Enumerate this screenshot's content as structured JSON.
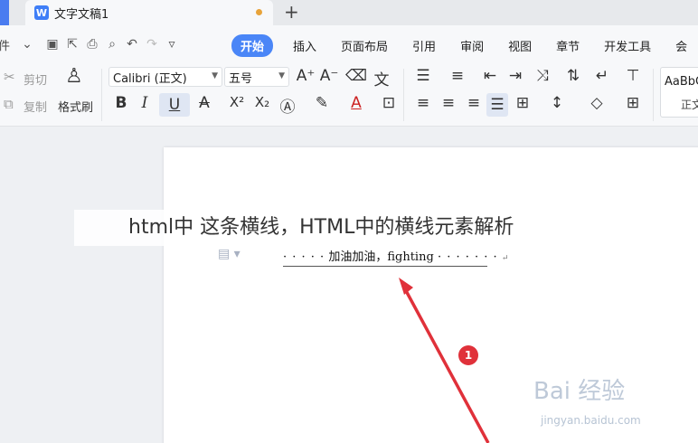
{
  "tabbar": {
    "doc_icon_letter": "W",
    "doc_title": "文字文稿1",
    "new_tab": "+"
  },
  "menubar": {
    "file_label": "件",
    "tabs": [
      {
        "label": "开始",
        "active": true
      },
      {
        "label": "插入"
      },
      {
        "label": "页面布局"
      },
      {
        "label": "引用"
      },
      {
        "label": "审阅"
      },
      {
        "label": "视图"
      },
      {
        "label": "章节"
      },
      {
        "label": "开发工具"
      }
    ],
    "more_label": "会"
  },
  "ribbon": {
    "cut_label": "剪切",
    "copy_label": "复制",
    "format_painter_label": "格式刷",
    "font_name": "Calibri (正文)",
    "font_size": "五号",
    "bold": "B",
    "italic": "I",
    "underline": "U",
    "strikethrough": "A",
    "superscript": "X²",
    "subscript": "X₂",
    "style_preview_top": "AaBbC",
    "style_preview_bottom": "正文"
  },
  "document": {
    "overlay_title": "html中 这条横线，HTML中的横线元素解析",
    "line_dots_left": "· · · · ·",
    "line_text": "加油加油，fighting",
    "line_dots_right": "· · · · · · ·"
  },
  "annotation": {
    "marker_number": "1",
    "arrow_color": "#e0313a"
  },
  "watermark": {
    "text": "Bai 经验",
    "subtext": "jingyan.baidu.com"
  }
}
